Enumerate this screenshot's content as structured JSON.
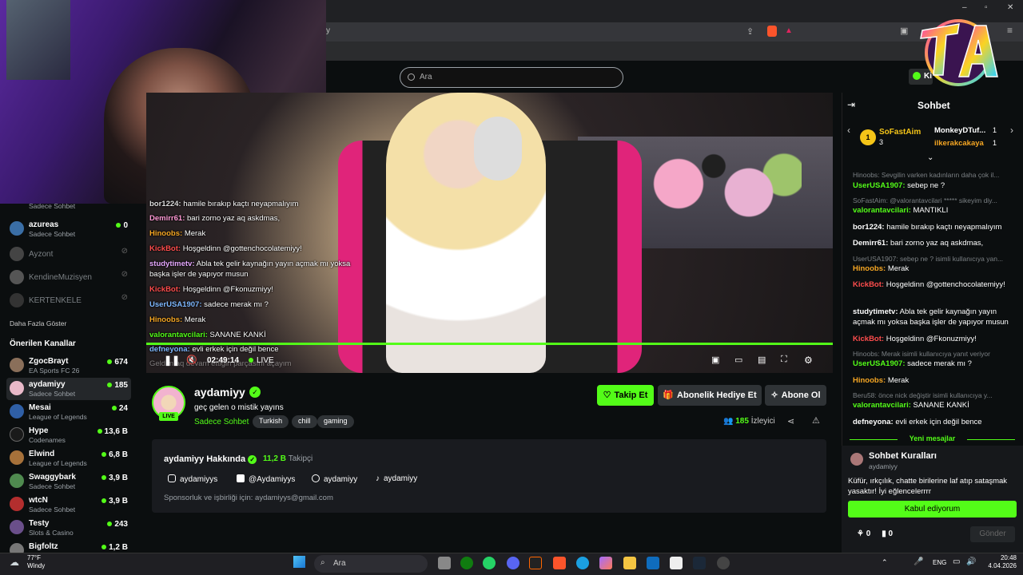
{
  "browser": {
    "url_fragment": "y"
  },
  "search": {
    "placeholder": "Ara"
  },
  "kick_button": {
    "label": "Ki"
  },
  "sidebar": {
    "top_items": [
      {
        "name": "azureas",
        "sub": "Sadece Sohbet",
        "count": "0",
        "online": true
      },
      {
        "name": "Ayzont",
        "online": false
      },
      {
        "name": "KendineMuzisyen",
        "online": false
      },
      {
        "name": "KERTENKELE",
        "online": false
      }
    ],
    "partial_item_sub": "Sadece Sohbet",
    "show_more": "Daha Fazla Göster",
    "recommended_header": "Önerilen Kanallar",
    "recommended": [
      {
        "name": "ZgocBrayt",
        "sub": "EA Sports FC 26",
        "count": "674"
      },
      {
        "name": "aydamiyy",
        "sub": "Sadece Sohbet",
        "count": "185"
      },
      {
        "name": "Mesai",
        "sub": "League of Legends",
        "count": "24"
      },
      {
        "name": "Hype",
        "sub": "Codenames",
        "count": "13,6 B"
      },
      {
        "name": "Elwind",
        "sub": "League of Legends",
        "count": "6,8 B"
      },
      {
        "name": "Swaggybark",
        "sub": "Sadece Sohbet",
        "count": "3,9 B"
      },
      {
        "name": "wtcN",
        "sub": "Sadece Sohbet",
        "count": "3,9 B"
      },
      {
        "name": "Testy",
        "sub": "Slots & Casino",
        "count": "243"
      },
      {
        "name": "Bigfoltz",
        "sub": "",
        "count": "1,2 B"
      }
    ]
  },
  "overlay_chat": [
    {
      "user": "bor1224:",
      "msg": "hamile bırakıp kaçtı neyapmalıyım"
    },
    {
      "user": "Demirr61:",
      "msg": "bari zorno yaz aq askdmas,"
    },
    {
      "user": "Hinoobs:",
      "msg": "Merak"
    },
    {
      "user": "KickBot:",
      "msg": "Hoşgeldinn @gottenchocolatemiyy!"
    },
    {
      "user": "studytimetv:",
      "msg": "Abla tek gelir kaynağın yayın açmak mı yoksa"
    },
    {
      "user": "",
      "msg": "başka işler de yapıyor musun"
    },
    {
      "user": "KickBot:",
      "msg": "Hoşgeldinn @Fkonuzmiyy!"
    },
    {
      "user": "UserUSA1907:",
      "msg": "sadece merak mı ?"
    },
    {
      "user": "Hinoobs:",
      "msg": "Merak"
    },
    {
      "user": "valorantavcilari:",
      "msg": "SANANE KANKİ"
    },
    {
      "user": "defneyona:",
      "msg": "evli erkek için değil bence"
    },
    {
      "user": "",
      "msg": "Geldim aq devam ettiğin parçasını açayım"
    }
  ],
  "player": {
    "time": "02:49:14",
    "live": "LIVE",
    "progress_pct": 100
  },
  "channel": {
    "name": "aydamiyy",
    "live_badge": "LIVE",
    "title": "geç gelen o mistik yayıns",
    "category": "Sadece Sohbet",
    "tags": [
      "Turkish",
      "chill",
      "gaming"
    ],
    "viewers": "185",
    "viewers_label": "İzleyici",
    "follow": "Takip Et",
    "gift": "Abonelik Hediye Et",
    "subscribe": "Abone Ol"
  },
  "about": {
    "title": "aydamiyy Hakkında",
    "followers": "11,2 B",
    "followers_label": "Takipçi",
    "socials": [
      "aydamiyys",
      "@Aydamiyys",
      "aydamiyy",
      "aydamiyy"
    ],
    "sponsor": "Sponsorluk ve işbirliği için: aydamiyys@gmail.com"
  },
  "chat": {
    "title": "Sohbet",
    "pinned": [
      {
        "name": "SoFastAim",
        "count": "3"
      },
      {
        "name": "MonkeyDTuf...",
        "count": "1"
      },
      {
        "name": "ilkerakcakaya",
        "count": "1"
      }
    ],
    "lines": [
      {
        "type": "reply",
        "text": "Hinoobs: Sevgilin varken kadınların daha çok il..."
      },
      {
        "user": "UserUSA1907:",
        "msg": "sebep ne ?",
        "color": "#53fc18"
      },
      {
        "type": "reply",
        "text": "SoFastAim: @valorantavcilari ***** sikeyim diy..."
      },
      {
        "user": "valorantavcilari:",
        "msg": "MANTIKLI",
        "color": "#53fc18"
      },
      {
        "user": "bor1224:",
        "msg": "hamile bırakıp kaçtı neyapmalıyım",
        "color": "#ffffff"
      },
      {
        "user": "Demirr61:",
        "msg": "bari zorno yaz aq askdmas,",
        "color": "#ffffff"
      },
      {
        "type": "reply",
        "text": "UserUSA1907: sebep ne ? isimli kullanıcıya yan..."
      },
      {
        "user": "Hinoobs:",
        "msg": "Merak",
        "color": "#f5a623"
      },
      {
        "user": "KickBot:",
        "msg": "Hoşgeldinn @gottenchocolatemiyy!",
        "color": "#ff4d4d"
      },
      {
        "user": "studytimetv:",
        "msg": "Abla tek gelir kaynağın yayın açmak mı yoksa başka işler de yapıyor musun",
        "color": "#ffffff"
      },
      {
        "user": "KickBot:",
        "msg": "Hoşgeldinn @Fkonuzmiyy!",
        "color": "#ff4d4d"
      },
      {
        "type": "reply",
        "text": "Hinoobs: Merak isimli kullanıcıya yanıt veriyor"
      },
      {
        "user": "UserUSA1907:",
        "msg": "sadece merak mı ?",
        "color": "#53fc18"
      },
      {
        "user": "Hinoobs:",
        "msg": "Merak",
        "color": "#f5a623"
      },
      {
        "type": "reply",
        "text": "Beru58: önce nick değiştir isimli kullanıcıya y..."
      },
      {
        "user": "valorantavcilari:",
        "msg": "SANANE KANKİ",
        "color": "#53fc18"
      },
      {
        "user": "defneyona:",
        "msg": "evli erkek için değil bence",
        "color": "#ffffff"
      }
    ],
    "new_messages": "Yeni mesajlar",
    "rules_title": "Sohbet Kuralları",
    "rules_user": "aydamiyy",
    "rules_text": "Küfür, ırkçılık, chatte birilerine laf atıp sataşmak yasaktır! İyi eğlencelerrrr",
    "accept": "Kabul ediyorum",
    "send": "Gönder",
    "stat1": "0",
    "stat2": "0"
  },
  "taskbar": {
    "temp": "77°F",
    "weather": "Windy",
    "search": "Ara",
    "lang": "ENG",
    "time": "20:48",
    "date": "4.04.2026"
  },
  "colors": {
    "accent": "#53fc18",
    "bg": "#0b0e0f",
    "panel": "#191b1f"
  }
}
